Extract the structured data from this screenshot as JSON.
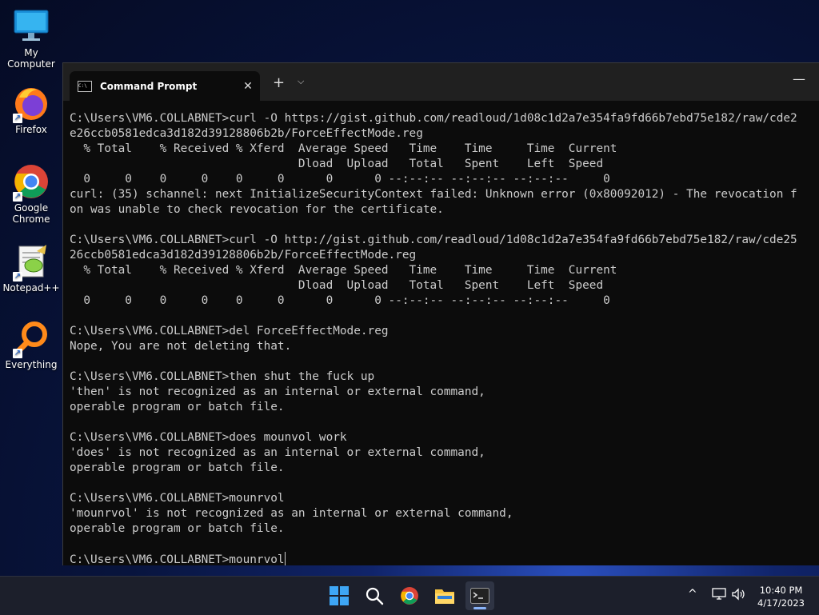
{
  "desktop": {
    "icons": [
      {
        "label": "My Computer"
      },
      {
        "label": "Firefox"
      },
      {
        "label": "Google Chrome"
      },
      {
        "label": "Notepad++"
      },
      {
        "label": "Everything"
      }
    ]
  },
  "window": {
    "tab_title": "Command Prompt",
    "tab_close": "✕",
    "new_tab": "+",
    "dropdown": "⌵",
    "minimize": "—"
  },
  "console": {
    "lines": [
      "C:\\Users\\VM6.COLLABNET>curl -O https://gist.github.com/readloud/1d08c1d2a7e354fa9fd66b7ebd75e182/raw/cde2",
      "e26ccb0581edca3d182d39128806b2b/ForceEffectMode.reg",
      "  % Total    % Received % Xferd  Average Speed   Time    Time     Time  Current",
      "                                 Dload  Upload   Total   Spent    Left  Speed",
      "  0     0    0     0    0     0      0      0 --:--:-- --:--:-- --:--:--     0",
      "curl: (35) schannel: next InitializeSecurityContext failed: Unknown error (0x80092012) - The revocation f",
      "on was unable to check revocation for the certificate.",
      "",
      "C:\\Users\\VM6.COLLABNET>curl -O http://gist.github.com/readloud/1d08c1d2a7e354fa9fd66b7ebd75e182/raw/cde25",
      "26ccb0581edca3d182d39128806b2b/ForceEffectMode.reg",
      "  % Total    % Received % Xferd  Average Speed   Time    Time     Time  Current",
      "                                 Dload  Upload   Total   Spent    Left  Speed",
      "  0     0    0     0    0     0      0      0 --:--:-- --:--:-- --:--:--     0",
      "",
      "C:\\Users\\VM6.COLLABNET>del ForceEffectMode.reg",
      "Nope, You are not deleting that.",
      "",
      "C:\\Users\\VM6.COLLABNET>then shut the fuck up",
      "'then' is not recognized as an internal or external command,",
      "operable program or batch file.",
      "",
      "C:\\Users\\VM6.COLLABNET>does mounvol work",
      "'does' is not recognized as an internal or external command,",
      "operable program or batch file.",
      "",
      "C:\\Users\\VM6.COLLABNET>mounrvol",
      "'mounrvol' is not recognized as an internal or external command,",
      "operable program or batch file.",
      "",
      "C:\\Users\\VM6.COLLABNET>mounrvol"
    ]
  },
  "taskbar": {
    "items": [
      {
        "name": "start-button"
      },
      {
        "name": "search-button"
      },
      {
        "name": "chrome-taskbar-button"
      },
      {
        "name": "file-explorer-taskbar-button"
      },
      {
        "name": "terminal-taskbar-button"
      }
    ],
    "tray": {
      "chevron": "^",
      "time": "10:40 PM",
      "date": "4/17/2023"
    }
  }
}
